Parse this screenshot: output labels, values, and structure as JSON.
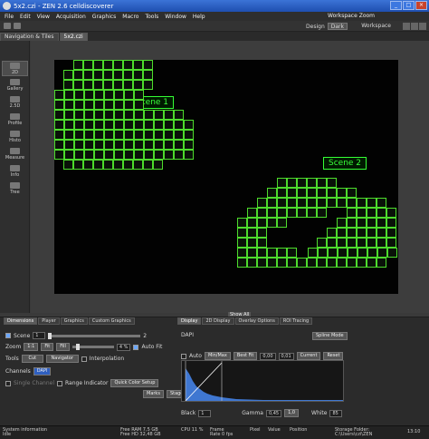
{
  "window": {
    "title": "5x2.czi - ZEN 2.6 celldiscoverer"
  },
  "menu": [
    "File",
    "Edit",
    "View",
    "Acquisition",
    "Graphics",
    "Macro",
    "Tools",
    "Window",
    "Help"
  ],
  "toolbar": {
    "workspace_zoom_label": "Workspace Zoom",
    "design_label": "Design",
    "design_value": "Dark",
    "workspace_label": "Workspace"
  },
  "tabs": [
    {
      "label": "Navigation & Tiles"
    },
    {
      "label": "5x2.czi"
    }
  ],
  "left_views": [
    "2D",
    "Gallery",
    "2.5D",
    "Profile",
    "Histo",
    "Measure",
    "Info",
    "Tree"
  ],
  "scenes": {
    "scene1": "Scene 1",
    "scene2": "Scene 2"
  },
  "show_all": "Show All",
  "left_tabs": [
    "Dimensions",
    "Player",
    "Graphics",
    "Custom Graphics"
  ],
  "right_tabs": [
    "Display",
    "2D Display",
    "Overlay Options",
    "ROI Tracing"
  ],
  "dimensions": {
    "scene_label": "Scene",
    "scene_value": "1",
    "scene_max": "2",
    "zoom_label": "Zoom",
    "zoom_btns": [
      "1:1",
      "Fit",
      "Fill"
    ],
    "zoom_value": "4 %",
    "auto_fit": "Auto Fit",
    "tools_label": "Tools",
    "tools_value": "Cut",
    "navigator": "Navigator",
    "interpolation": "Interpolation",
    "channels_label": "Channels",
    "channel_name": "DAPI",
    "single_channel": "Single Channel",
    "range_indicator": "Range Indicator",
    "quick_color": "Quick Color Setup",
    "markers": "Marks",
    "stage": "Stage"
  },
  "display": {
    "channel": "DAPI",
    "spline_mode": "Spline Mode",
    "auto": "Auto",
    "min_max": "Min/Max",
    "best_fit": "Best Fit",
    "best_fit_lo": "0,00",
    "best_fit_hi": "0,01",
    "current": "Current",
    "reset": "Reset",
    "black_label": "Black",
    "black_value": "1",
    "gamma_label": "Gamma",
    "gamma_value": "0,45",
    "gamma_hi": "1,0",
    "white_label": "White",
    "white_value": "85"
  },
  "status": {
    "system_info": "System information",
    "system_sub": "Idle",
    "free_ram": "Free RAM 7,5 GB",
    "free_hd": "Free HD 32,48 GB",
    "cpu": "CPU 11 %",
    "frame_rate": "Frame Rate 0 fps",
    "pixel": "Pixel",
    "value": "Value",
    "position": "Position",
    "storage": "Storage Folder:",
    "storage_path": "C:\\Users\\czi\\ZEN",
    "time": "13:10"
  },
  "colors": {
    "tile_border": "#4ddc2c",
    "label": "#35ff35"
  }
}
